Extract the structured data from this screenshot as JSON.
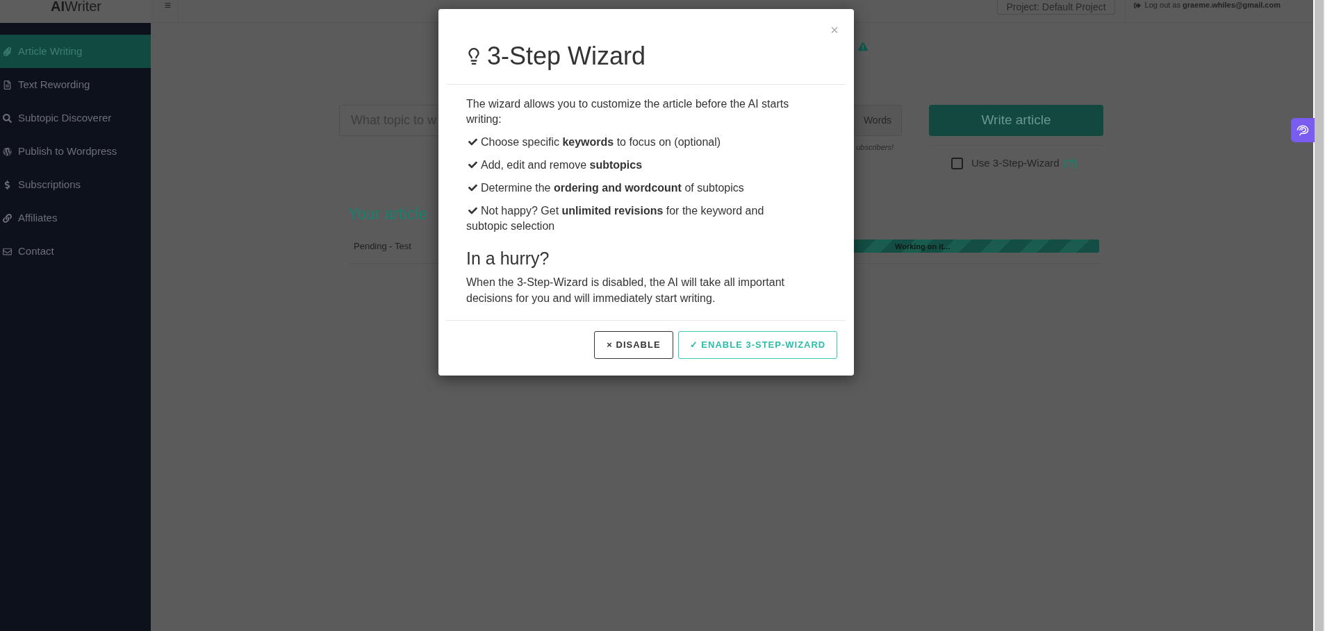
{
  "app": {
    "logo_bold": "AI",
    "logo_rest": "Writer",
    "menu_glyph": "≡"
  },
  "sidebar": {
    "items": [
      {
        "label": "Article Writing",
        "selected": true
      },
      {
        "label": "Text Rewording",
        "selected": false
      },
      {
        "label": "Subtopic Discoverer",
        "selected": false
      },
      {
        "label": "Publish to Wordpress",
        "selected": false
      },
      {
        "label": "Subscriptions",
        "selected": false
      },
      {
        "label": "Affiliates",
        "selected": false
      },
      {
        "label": "Contact",
        "selected": false
      }
    ]
  },
  "topbar": {
    "project": "Project: Default Project",
    "logout_prefix": "Log out as",
    "logout_email": "graeme.whiles@gmail.com"
  },
  "composer": {
    "topic_placeholder": "What topic to w",
    "words_label": "Words",
    "note": "ubscribers!",
    "write_button": "Write article",
    "wizard_checkbox": {
      "label": "Use 3-Step-Wizard",
      "help": "(?)",
      "checked": false
    }
  },
  "articles": {
    "title": "Your article",
    "rows": [
      {
        "name": "Pending - Test",
        "status": "Working on it...",
        "level": 1
      }
    ]
  },
  "modal": {
    "title": "3-Step Wizard",
    "close": "×",
    "intro": "The wizard allows you to customize the article before the AI starts writing:",
    "points": [
      "Choose specific **keywords** to focus on (optional)",
      "Add, edit and remove **subtopics**",
      "Determine the **ordering and wordcount** of subtopics",
      "Not happy? Get **unlimited revisions** for the keyword and subtopic selection"
    ],
    "subheading": "In a hurry?",
    "note": "When the 3-Step-Wizard is disabled, the AI will take all important decisions for you and will immediately start writing.",
    "buttons": [
      {
        "label": "× DISABLE",
        "kind": "secondary"
      },
      {
        "label": "✓ ENABLE 3-STEP-WIZARD",
        "kind": "primary"
      }
    ]
  }
}
